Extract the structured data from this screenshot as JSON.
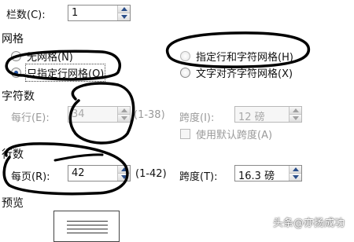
{
  "columns": {
    "label": "栏数(C):",
    "value": "1"
  },
  "grid": {
    "title": "网格",
    "options": [
      {
        "label": "无网格(N)",
        "checked": false,
        "disabled": false
      },
      {
        "label": "只指定行网格(O)",
        "checked": true,
        "disabled": false
      },
      {
        "label": "指定行和字符网格(H)",
        "checked": false,
        "disabled": true
      },
      {
        "label": "文字对齐字符网格(X)",
        "checked": false,
        "disabled": false
      }
    ]
  },
  "chars": {
    "title": "字符数",
    "per_line_label": "每行(E):",
    "per_line_value": "34",
    "per_line_range": "(1-38)",
    "pitch_label": "跨度(I):",
    "pitch_value": "12 磅",
    "default_pitch_label": "使用默认跨度(A)"
  },
  "lines": {
    "title": "行数",
    "per_page_label": "每页(R):",
    "per_page_value": "42",
    "per_page_range": "(1-42)",
    "pitch_label": "跨度(T):",
    "pitch_value": "16.3 磅"
  },
  "preview": {
    "title": "预览"
  },
  "watermark": "头条@亦扬成功"
}
